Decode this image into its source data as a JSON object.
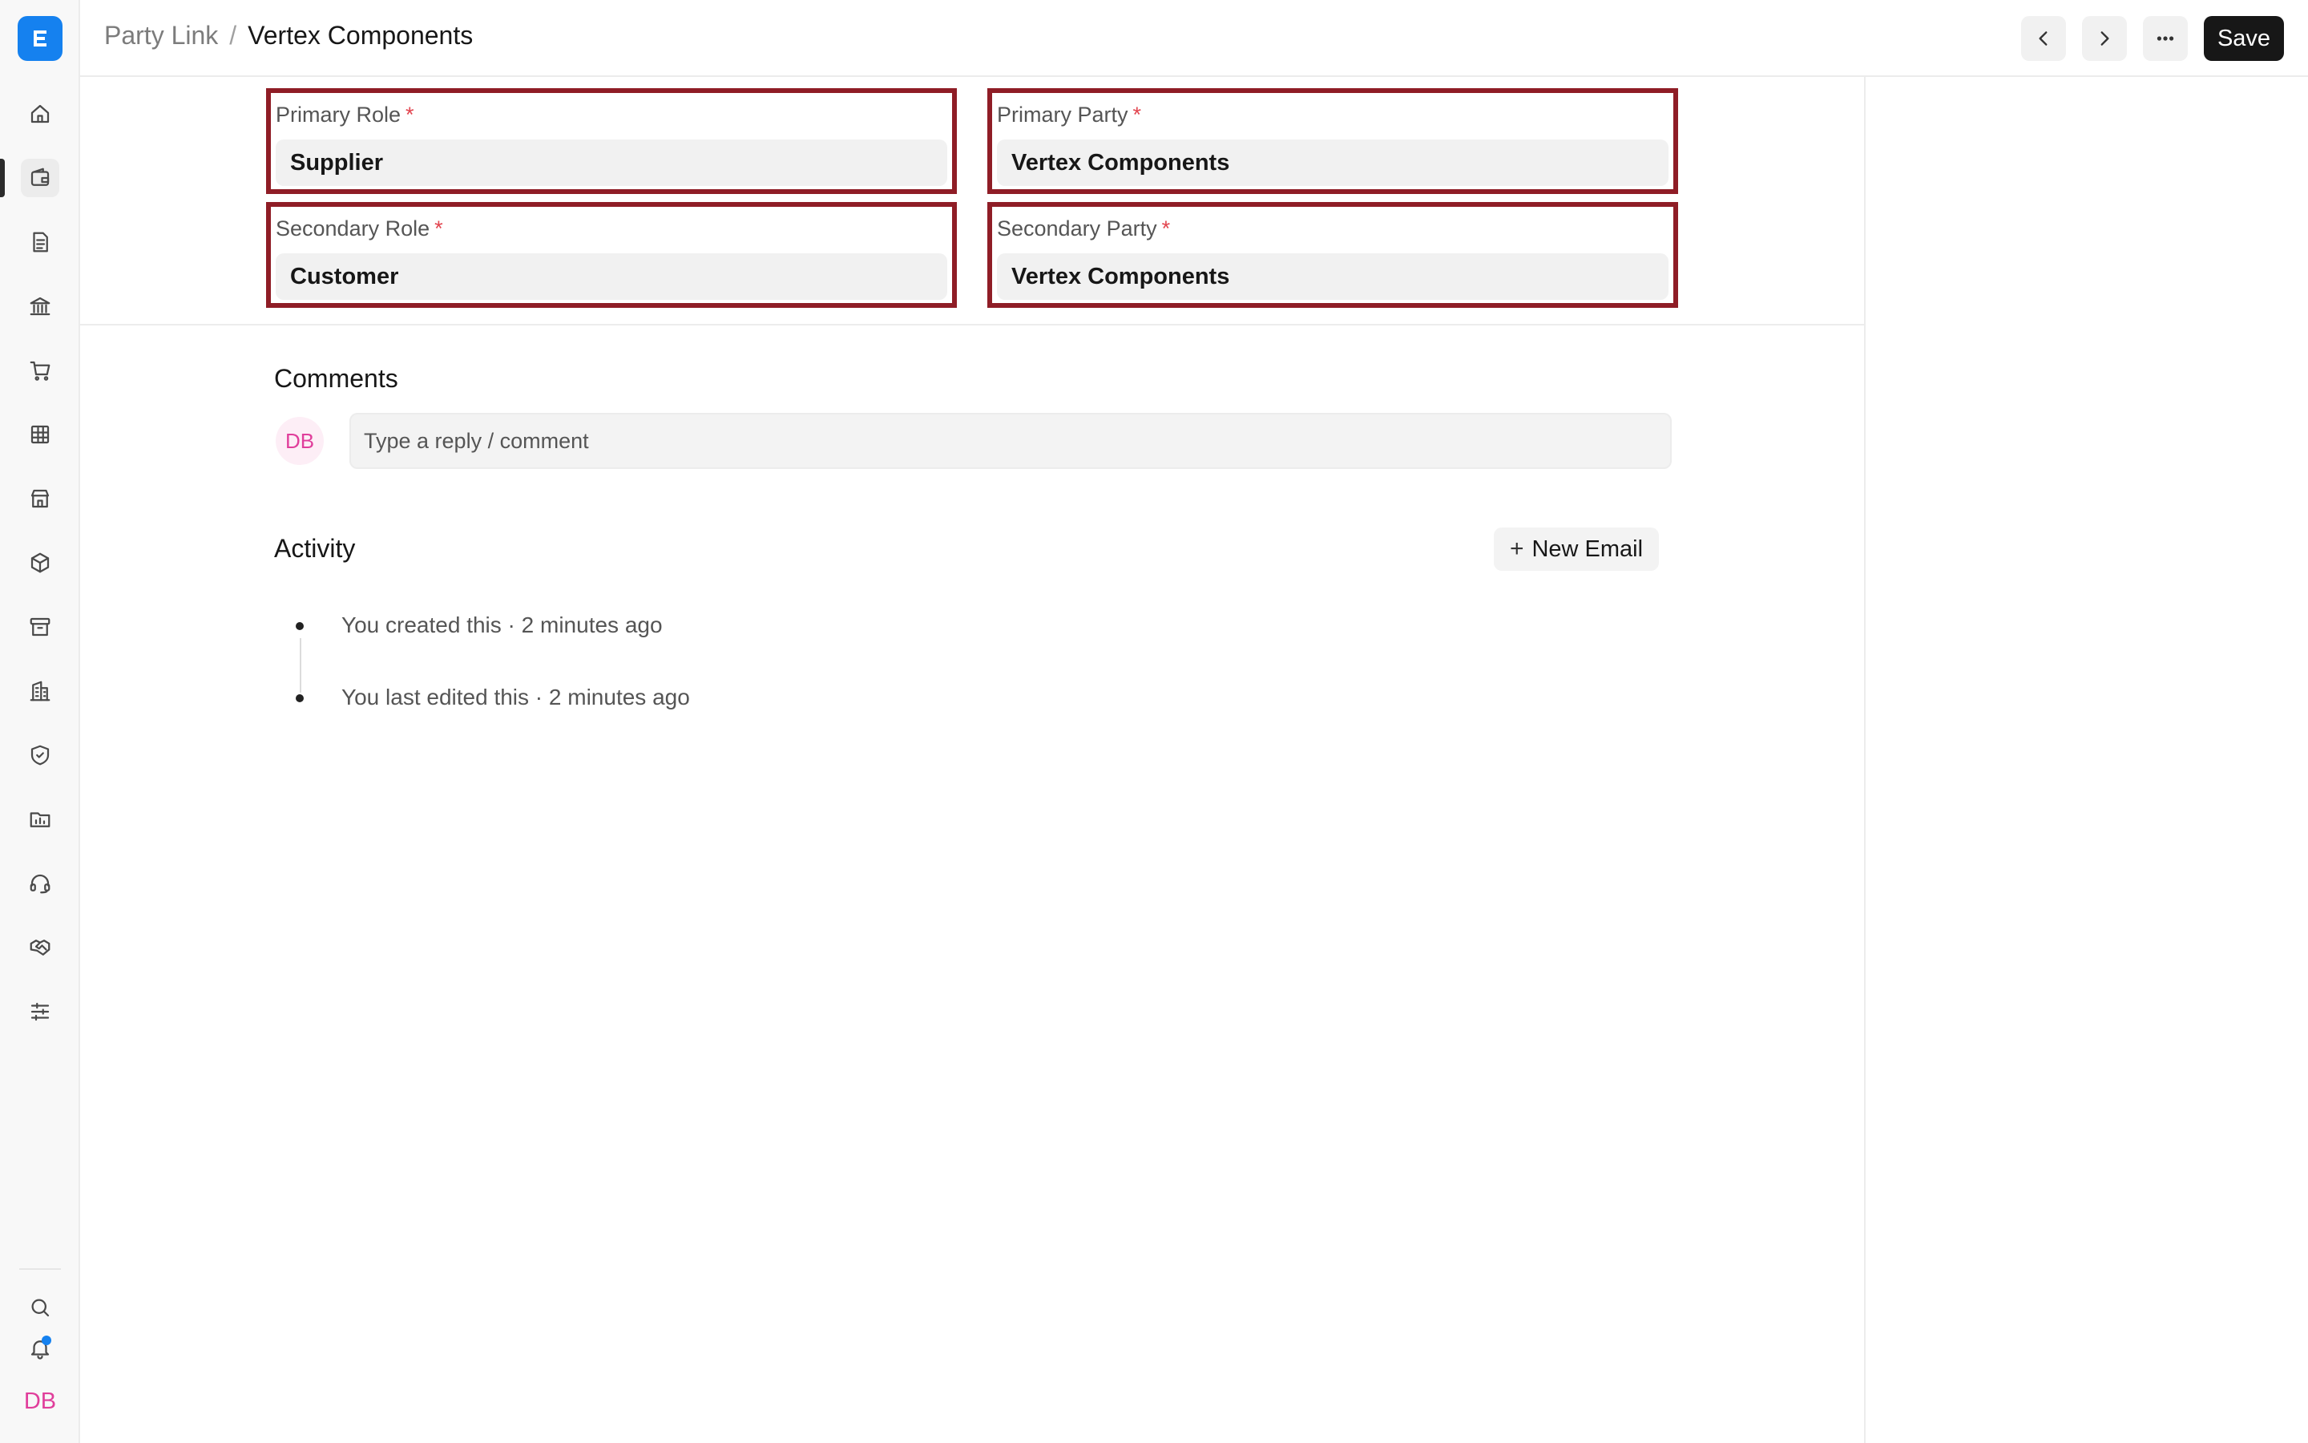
{
  "app": {
    "accent": "#1581ef",
    "logo_icon": "app-logo-icon"
  },
  "breadcrumb": {
    "parent": "Party Link",
    "separator": "/",
    "current": "Vertex Components"
  },
  "header": {
    "prev_icon": "chevron-left-icon",
    "next_icon": "chevron-right-icon",
    "more_icon": "more-horizontal-icon",
    "save_label": "Save"
  },
  "sidebar": {
    "items": [
      {
        "icon": "home-icon"
      },
      {
        "icon": "wallet-icon",
        "active": true
      },
      {
        "icon": "file-text-icon"
      },
      {
        "icon": "bank-icon"
      },
      {
        "icon": "shopping-cart-icon"
      },
      {
        "icon": "table-icon"
      },
      {
        "icon": "store-icon"
      },
      {
        "icon": "package-icon"
      },
      {
        "icon": "archive-icon"
      },
      {
        "icon": "building-icon"
      },
      {
        "icon": "shield-check-icon"
      },
      {
        "icon": "folder-chart-icon"
      },
      {
        "icon": "headset-icon"
      },
      {
        "icon": "handshake-icon"
      },
      {
        "icon": "sliders-icon"
      }
    ],
    "bottom": {
      "search_icon": "search-icon",
      "bell_icon": "bell-icon",
      "avatar_initials": "DB"
    }
  },
  "form": {
    "primary_role": {
      "label": "Primary Role",
      "required": "*",
      "value": "Supplier"
    },
    "primary_party": {
      "label": "Primary Party",
      "required": "*",
      "value": "Vertex Components"
    },
    "secondary_role": {
      "label": "Secondary Role",
      "required": "*",
      "value": "Customer"
    },
    "secondary_party": {
      "label": "Secondary Party",
      "required": "*",
      "value": "Vertex Components"
    },
    "highlight_color": "#8f1d26"
  },
  "comments": {
    "title": "Comments",
    "avatar_initials": "DB",
    "placeholder": "Type a reply / comment"
  },
  "activity": {
    "title": "Activity",
    "new_email_label": "New Email",
    "items": [
      {
        "text": "You created this · 2 minutes ago"
      },
      {
        "text": "You last edited this · 2 minutes ago"
      }
    ]
  }
}
